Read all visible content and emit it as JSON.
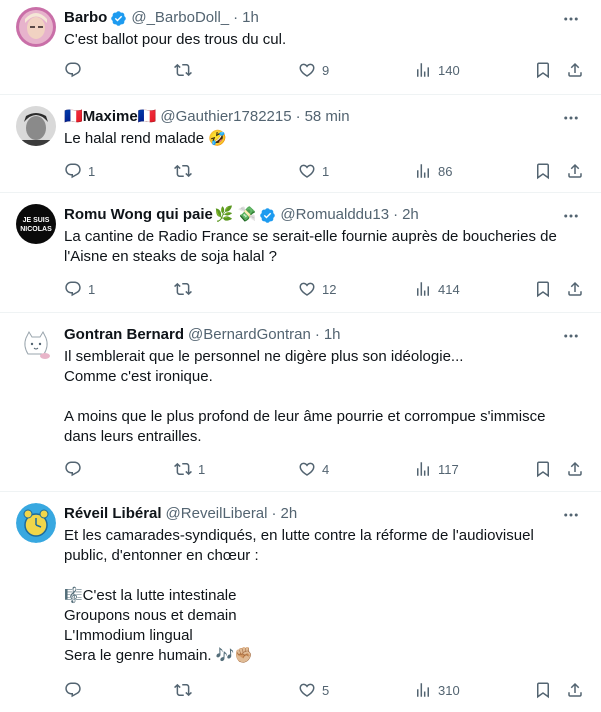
{
  "tweets": [
    {
      "name": "Barbo",
      "verified": true,
      "handle": "@_BarboDoll_",
      "time": "1h",
      "text": "C'est ballot pour des trous du cul.",
      "replies": "",
      "retweets": "",
      "likes": "9",
      "views": "140"
    },
    {
      "name_prefix": "🇫🇷",
      "name": "Maxime",
      "name_suffix": "🇫🇷",
      "verified": false,
      "handle": "@Gauthier1782215",
      "time": "58 min",
      "text": "Le halal rend malade 🤣",
      "replies": "1",
      "retweets": "",
      "likes": "1",
      "views": "86"
    },
    {
      "name": "Romu Wong qui paie",
      "name_suffix": "🌿 💸",
      "verified": true,
      "handle": "@Romualddu13",
      "time": "2h",
      "text": "La cantine de Radio France se serait-elle fournie auprès de boucheries de l'Aisne en steaks de soja halal ?",
      "replies": "1",
      "retweets": "",
      "likes": "12",
      "views": "414",
      "avatar_text": "JE SUIS NICOLAS"
    },
    {
      "name": "Gontran Bernard",
      "verified": false,
      "handle": "@BernardGontran",
      "time": "1h",
      "text": "Il semblerait que le personnel ne digère plus son idéologie...\nComme c'est ironique.\n\nA moins que le plus profond de leur âme pourrie et corrompue s'immisce dans leurs entrailles.",
      "replies": "",
      "retweets": "1",
      "likes": "4",
      "views": "117"
    },
    {
      "name": "Réveil Libéral",
      "verified": false,
      "handle": "@ReveilLiberal",
      "time": "2h",
      "text": "Et les camarades-syndiqués, en lutte contre la réforme de l'audiovisuel public, d'entonner en chœur :\n\n🎼C'est la lutte intestinale\nGroupons nous et demain\nL'Immodium lingual\nSera le genre humain. 🎶✊🏼",
      "replies": "",
      "retweets": "",
      "likes": "5",
      "views": "310"
    }
  ],
  "colors": {
    "text": "#0f1419",
    "secondary": "#536471",
    "verified": "#1d9bf0",
    "divider": "#eff3f4"
  }
}
